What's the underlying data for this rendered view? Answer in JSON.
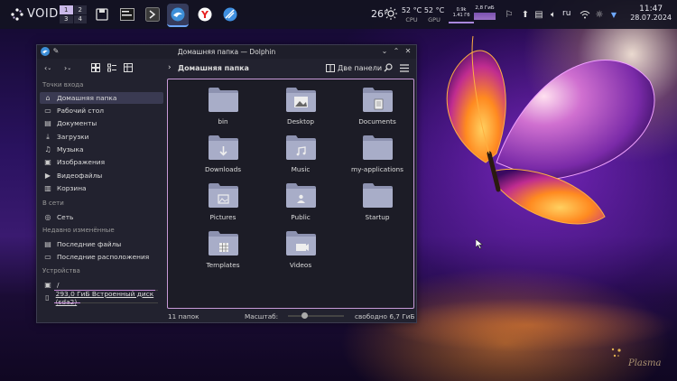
{
  "panel": {
    "logo_text": "VOID",
    "pager": [
      "1",
      "2",
      "3",
      "4"
    ],
    "weather_temp": "26°",
    "cpu_temp": "52 °C",
    "cpu_label": "CPU",
    "gpu_temp": "52 °C",
    "gpu_label": "GPU",
    "net_down": "0.9k",
    "net_up": "1.41 Гб",
    "mem": "2,8 ГиБ",
    "lang": "ru",
    "time": "11:47",
    "date": "28.07.2024"
  },
  "window": {
    "title": "Домашняя папка — Dolphin",
    "breadcrumb": "Домашняя папка",
    "split_label": "Две панели"
  },
  "sidebar": {
    "sections": [
      "Точки входа",
      "В сети",
      "Недавно изменённые",
      "Устройства"
    ],
    "places": [
      {
        "label": "Домашняя папка",
        "icon": "home-icon"
      },
      {
        "label": "Рабочий стол",
        "icon": "desktop-icon"
      },
      {
        "label": "Документы",
        "icon": "documents-icon"
      },
      {
        "label": "Загрузки",
        "icon": "downloads-icon"
      },
      {
        "label": "Музыка",
        "icon": "music-icon"
      },
      {
        "label": "Изображения",
        "icon": "pictures-icon"
      },
      {
        "label": "Видеофайлы",
        "icon": "videos-icon"
      },
      {
        "label": "Корзина",
        "icon": "trash-icon"
      }
    ],
    "network": [
      {
        "label": "Сеть",
        "icon": "network-icon"
      }
    ],
    "recent": [
      {
        "label": "Последние файлы",
        "icon": "recent-files-icon"
      },
      {
        "label": "Последние расположения",
        "icon": "recent-locations-icon"
      }
    ],
    "devices": [
      {
        "label": "/",
        "icon": "root-drive-icon",
        "usage": 0.97
      },
      {
        "label": "293,0 ГиБ Встроенный диск (sda2)",
        "icon": "drive-icon",
        "usage": 0.25
      }
    ]
  },
  "folders": [
    {
      "name": "bin",
      "type": "plain"
    },
    {
      "name": "Desktop",
      "type": "desktop"
    },
    {
      "name": "Documents",
      "type": "documents"
    },
    {
      "name": "Downloads",
      "type": "downloads"
    },
    {
      "name": "Music",
      "type": "music"
    },
    {
      "name": "my-applications",
      "type": "plain"
    },
    {
      "name": "Pictures",
      "type": "pictures"
    },
    {
      "name": "Public",
      "type": "public"
    },
    {
      "name": "Startup",
      "type": "plain"
    },
    {
      "name": "Templates",
      "type": "templates"
    },
    {
      "name": "Videos",
      "type": "videos"
    }
  ],
  "status": {
    "count": "11 папок",
    "zoom_label": "Масштаб:",
    "zoom_level": 0.3,
    "free": "свободно 6,7 ГиБ"
  },
  "desktop": {
    "watermark": "Plasma"
  },
  "colors": {
    "accent": "#6ea8ff",
    "selection_border": "#c89ad8"
  }
}
